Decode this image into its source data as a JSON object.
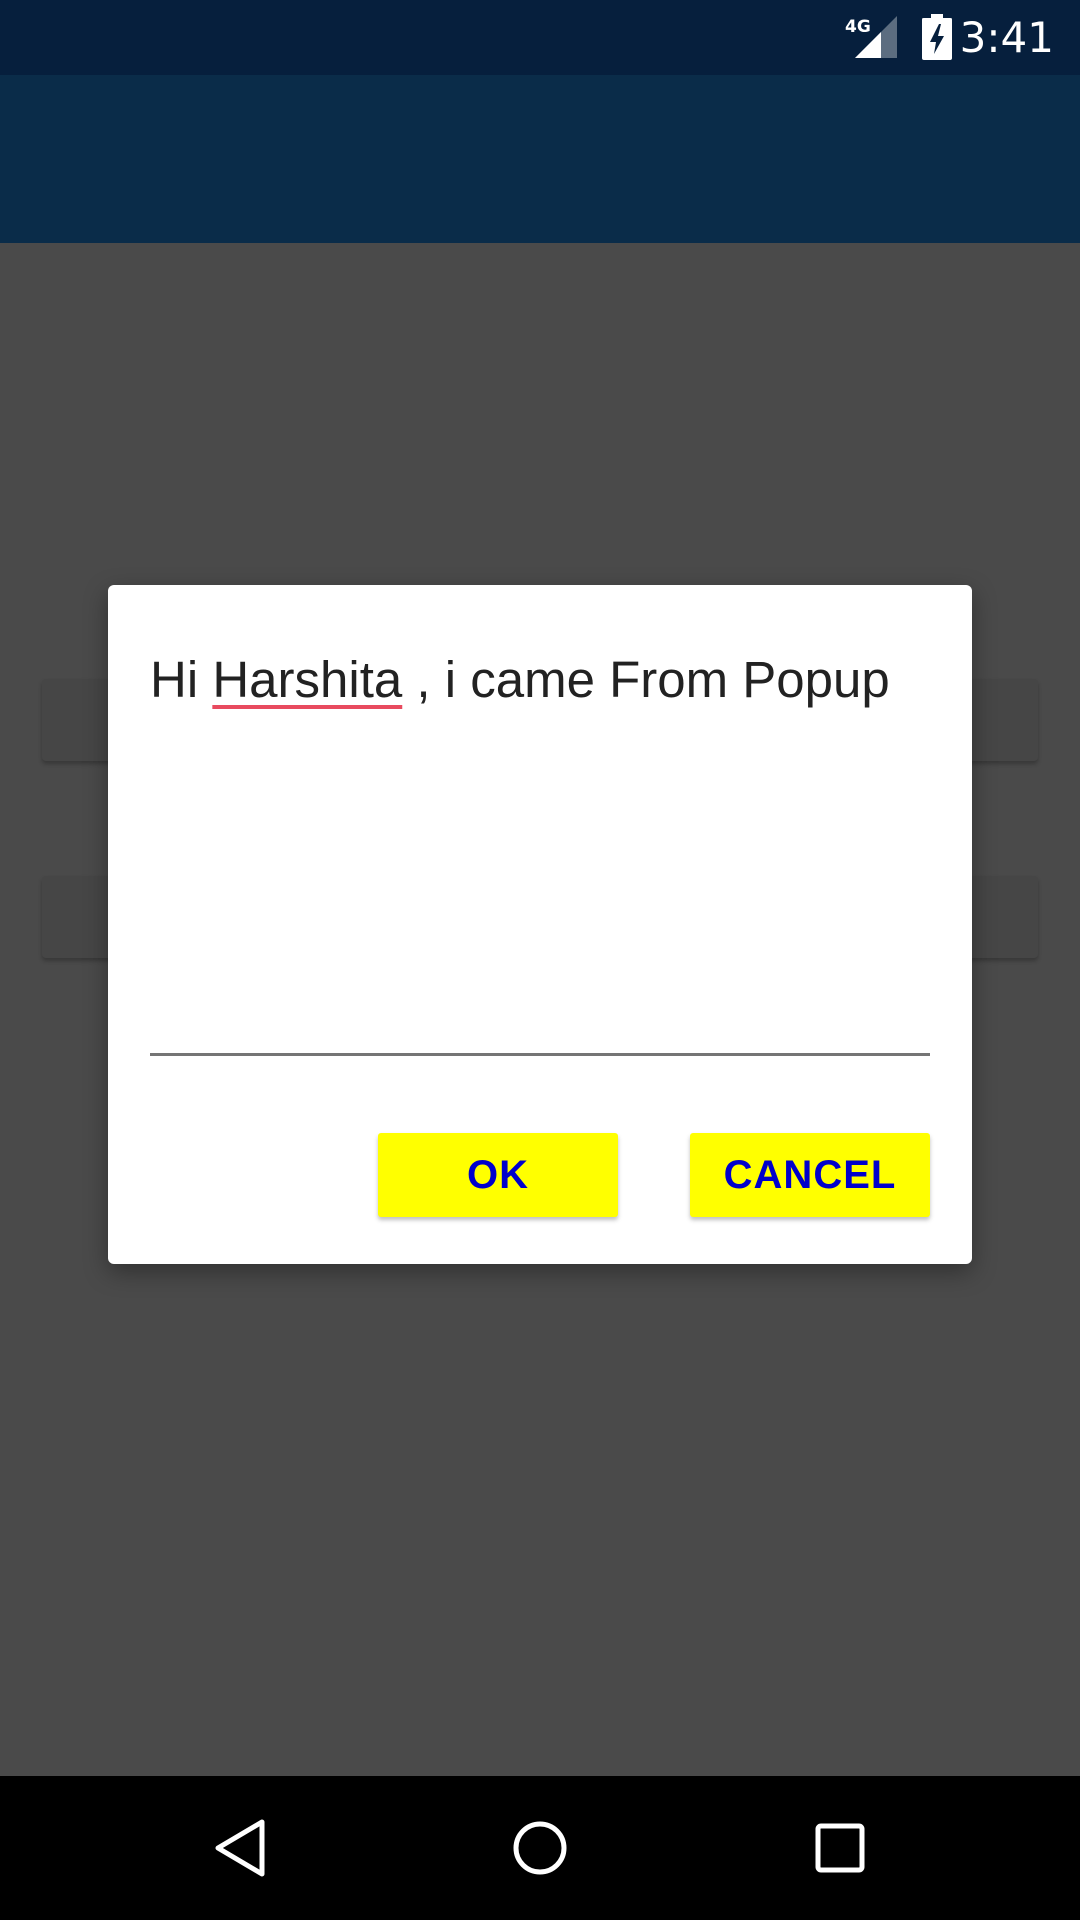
{
  "status_bar": {
    "network_label": "4G",
    "time": "3:41",
    "signal_icon": "signal-icon",
    "battery_icon": "battery-charging-icon"
  },
  "dialog": {
    "message_prefix": "Hi ",
    "message_name": "Harshita",
    "message_suffix": " , i came From Popup",
    "input_value": "",
    "ok_label": "OK",
    "cancel_label": "CANCEL"
  },
  "nav_bar": {
    "back_icon": "back-icon",
    "home_icon": "home-icon",
    "recent_icon": "recent-apps-icon"
  },
  "colors": {
    "status_bar": "#061f3d",
    "app_bar": "#0a2c49",
    "dim_background": "#4a4a4a",
    "button_background": "#ffff00",
    "button_text": "#0000cc",
    "spellcheck_underline": "#e84a5f"
  }
}
